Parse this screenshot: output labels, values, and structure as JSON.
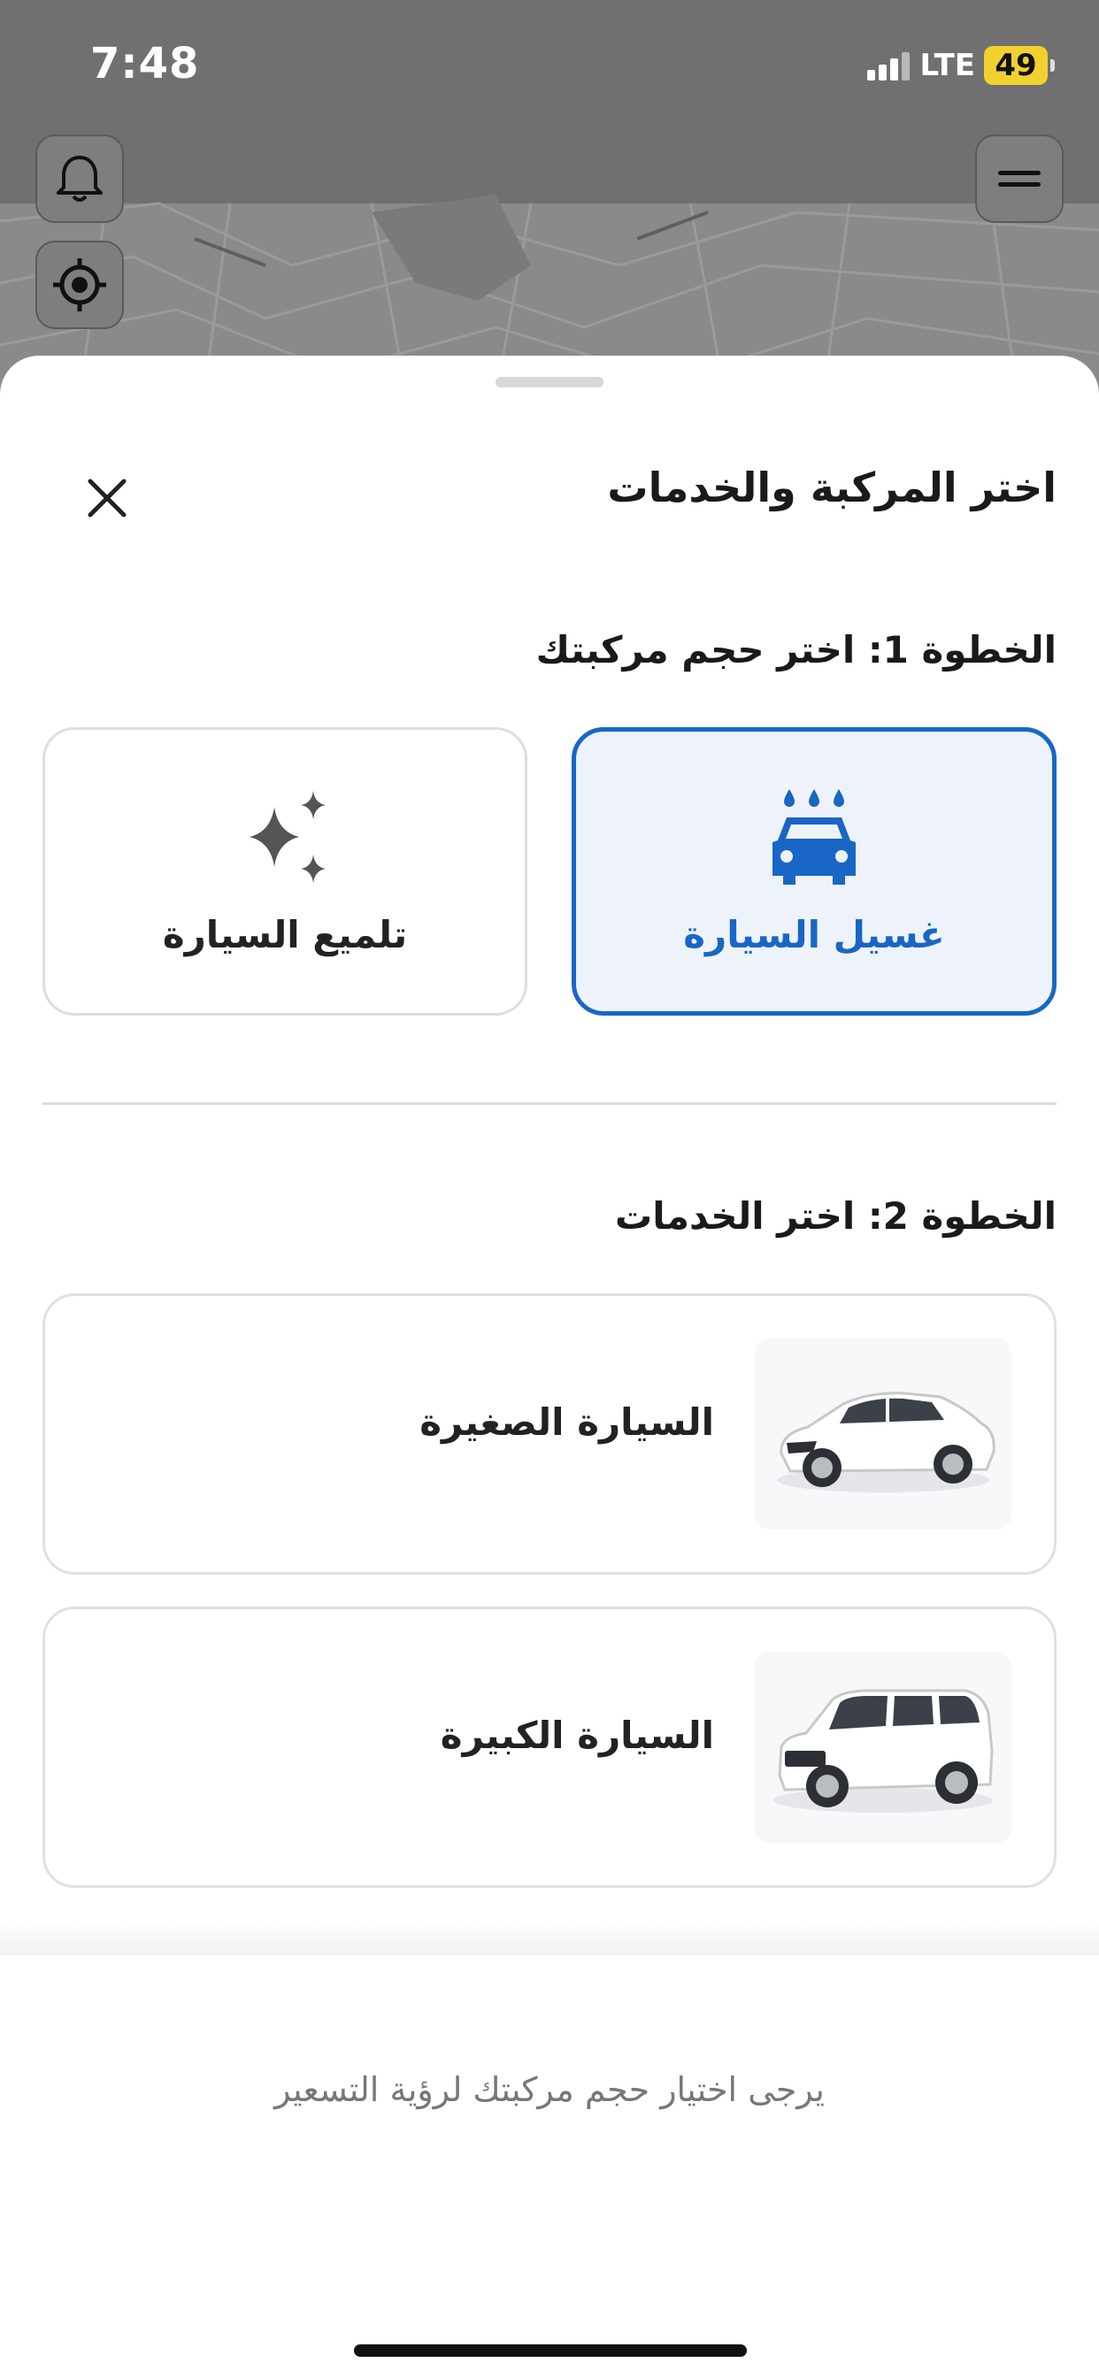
{
  "status_bar": {
    "time": "7:48",
    "network": "LTE",
    "battery": "49"
  },
  "sheet": {
    "title": "اختر المركبة والخدمات",
    "step1": {
      "title": "الخطوة 1: اختر حجم مركبتك",
      "options": [
        {
          "label": "غسيل السيارة",
          "icon": "car-wash-icon",
          "selected": true
        },
        {
          "label": "تلميع السيارة",
          "icon": "sparkles-icon",
          "selected": false
        }
      ]
    },
    "step2": {
      "title": "الخطوة 2: اختر الخدمات",
      "vehicles": [
        {
          "label": "السيارة الصغيرة",
          "image": "sedan-car-image"
        },
        {
          "label": "السيارة الكبيرة",
          "image": "suv-car-image"
        }
      ]
    }
  },
  "footer": {
    "note": "يرجى اختيار حجم مركبتك لرؤية التسعير"
  },
  "colors": {
    "accent": "#1966c6",
    "selected_bg": "#eef3fb",
    "battery": "#f2d12e"
  }
}
